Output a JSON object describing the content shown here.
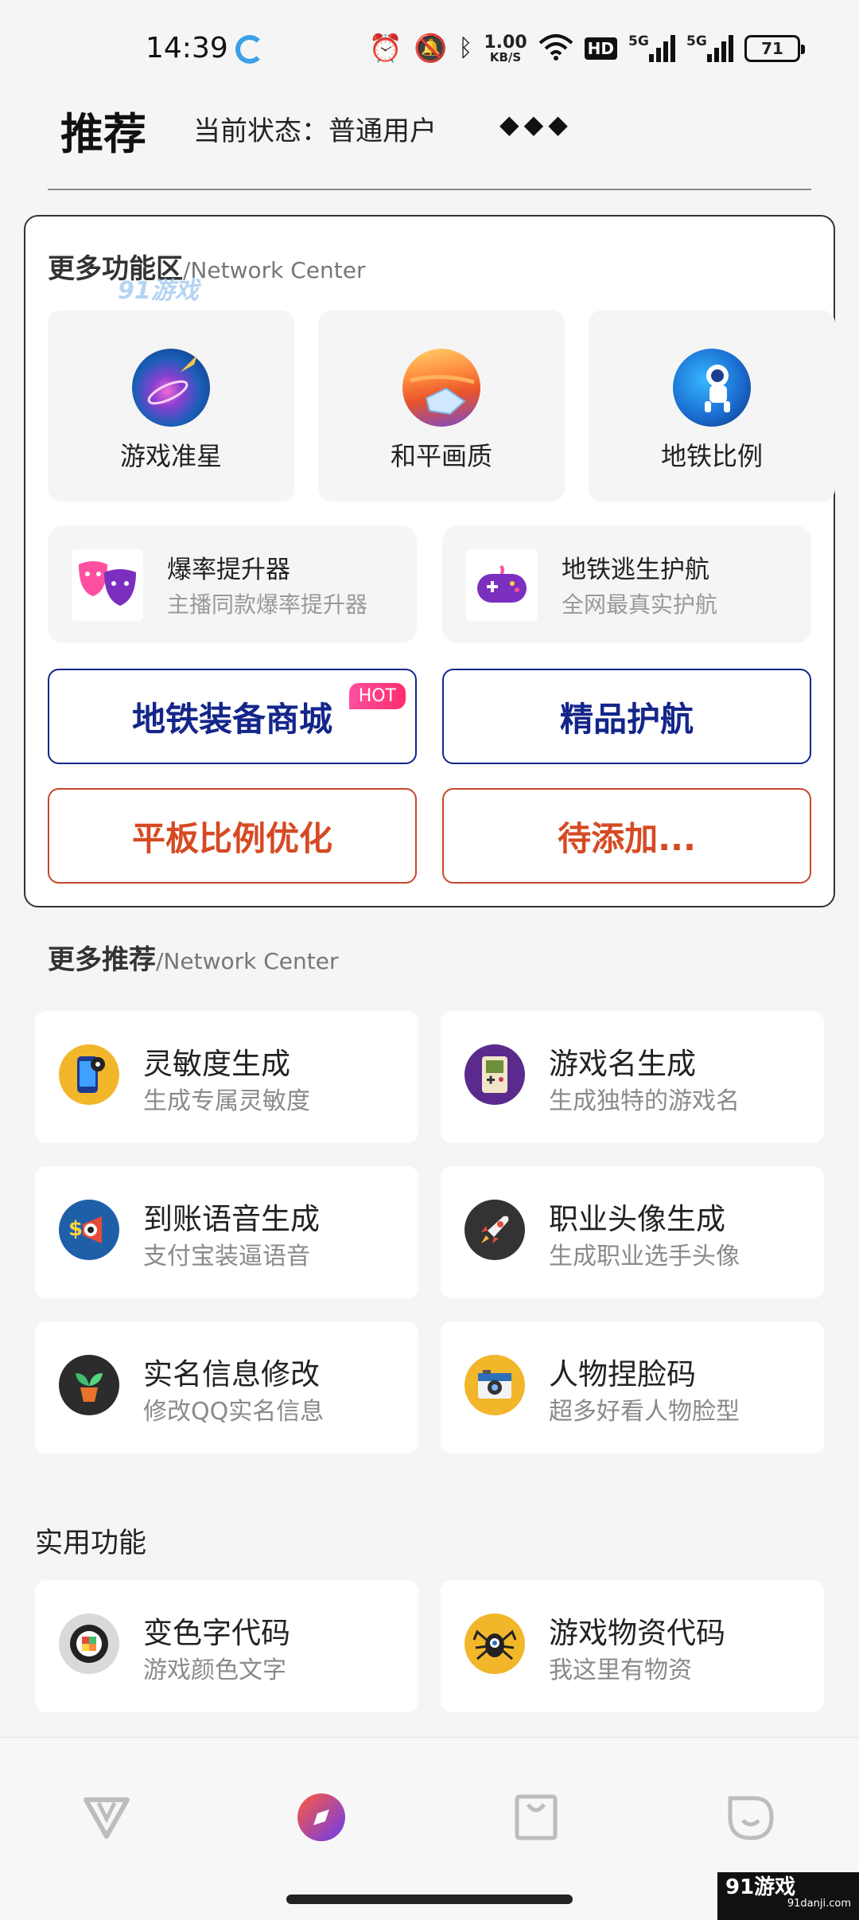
{
  "status_bar": {
    "time": "14:39",
    "net_speed_value": "1.00",
    "net_speed_unit": "KB/S",
    "hd_label": "HD",
    "sim1_label": "5G",
    "sim2_label": "5G",
    "battery": "71"
  },
  "header": {
    "title": "推荐",
    "status_text": "当前状态：普通用户",
    "diamonds": "◆◆◆"
  },
  "features": {
    "section_title": "更多功能区",
    "section_subtitle": "/Network Center",
    "watermark": "91游戏",
    "big_tiles": [
      {
        "label": "游戏准星",
        "icon": "galaxy-rocket-icon"
      },
      {
        "label": "和平画质",
        "icon": "planet-icon"
      },
      {
        "label": "地铁比例",
        "icon": "astronaut-icon"
      }
    ],
    "wide_tiles": [
      {
        "title": "爆率提升器",
        "subtitle": "主播同款爆率提升器",
        "icon": "theater-masks-icon"
      },
      {
        "title": "地铁逃生护航",
        "subtitle": "全网最真实护航",
        "icon": "gamepad-icon"
      }
    ],
    "buttons": [
      {
        "label": "地铁装备商城",
        "badge": "HOT",
        "color": "#14268a"
      },
      {
        "label": "精品护航",
        "color": "#14268a"
      },
      {
        "label": "平板比例优化",
        "color": "#d64a23"
      },
      {
        "label": "待添加...",
        "color": "#d64a23"
      }
    ]
  },
  "recommend": {
    "section_title": "更多推荐",
    "section_subtitle": "/Network Center",
    "cards": [
      {
        "title": "灵敏度生成",
        "subtitle": "生成专属灵敏度",
        "icon": "phone-settings-icon"
      },
      {
        "title": "游戏名生成",
        "subtitle": "生成独特的游戏名",
        "icon": "gameboy-icon"
      },
      {
        "title": "到账语音生成",
        "subtitle": "支付宝装逼语音",
        "icon": "money-megaphone-icon"
      },
      {
        "title": "职业头像生成",
        "subtitle": "生成职业选手头像",
        "icon": "rocket-icon"
      },
      {
        "title": "实名信息修改",
        "subtitle": "修改QQ实名信息",
        "icon": "plant-icon"
      },
      {
        "title": "人物捏脸码",
        "subtitle": "超多好看人物脸型",
        "icon": "camera-icon"
      }
    ]
  },
  "utility": {
    "section_title": "实用功能",
    "cards": [
      {
        "title": "变色字代码",
        "subtitle": "游戏颜色文字",
        "icon": "sushi-icon"
      },
      {
        "title": "游戏物资代码",
        "subtitle": "我这里有物资",
        "icon": "spider-icon"
      }
    ]
  },
  "bottom_nav": [
    "v-logo-icon",
    "compass-icon",
    "bag-icon",
    "face-icon"
  ],
  "corner_logo": {
    "text": "91游戏",
    "domain": "91danji.com"
  }
}
